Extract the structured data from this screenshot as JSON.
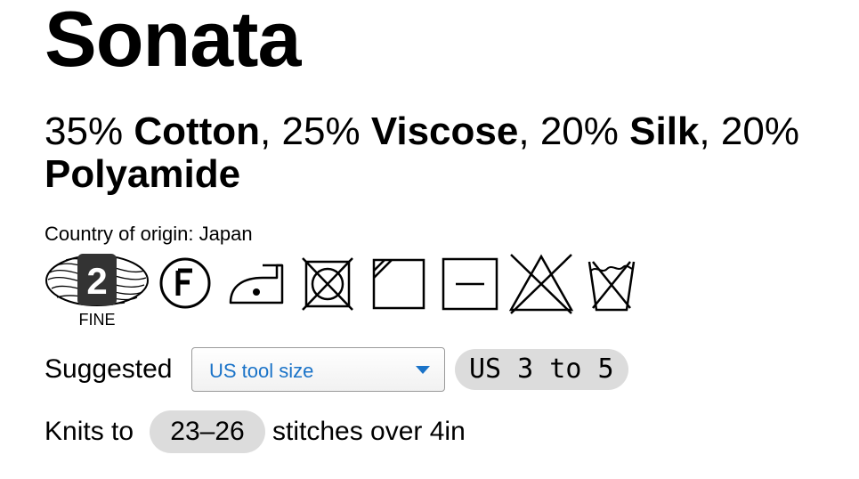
{
  "product": {
    "name": "Sonata"
  },
  "fibers": [
    {
      "percent": "35%",
      "name": "Cotton",
      "sep": ","
    },
    {
      "percent": "25%",
      "name": "Viscose",
      "sep": ","
    },
    {
      "percent": "20%",
      "name": "Silk",
      "sep": ","
    },
    {
      "percent": "20%",
      "name": "Polyamide",
      "sep": ""
    }
  ],
  "origin": {
    "text": "Country of origin: Japan"
  },
  "care": {
    "weight_number": "2",
    "weight_label": "FINE",
    "icons": [
      "yarn-weight-fine-icon",
      "dry-clean-f-icon",
      "iron-low-heat-icon",
      "do-not-tumble-dry-icon",
      "dry-in-shade-icon",
      "dry-flat-icon",
      "do-not-bleach-icon",
      "do-not-wash-icon"
    ]
  },
  "tool": {
    "label": "Suggested",
    "select_value": "US tool size",
    "size_value": "US 3 to 5",
    "accent_color": "#1a73c8"
  },
  "gauge": {
    "prefix": "Knits to",
    "value": "23–26",
    "suffix": "stitches over 4in"
  }
}
